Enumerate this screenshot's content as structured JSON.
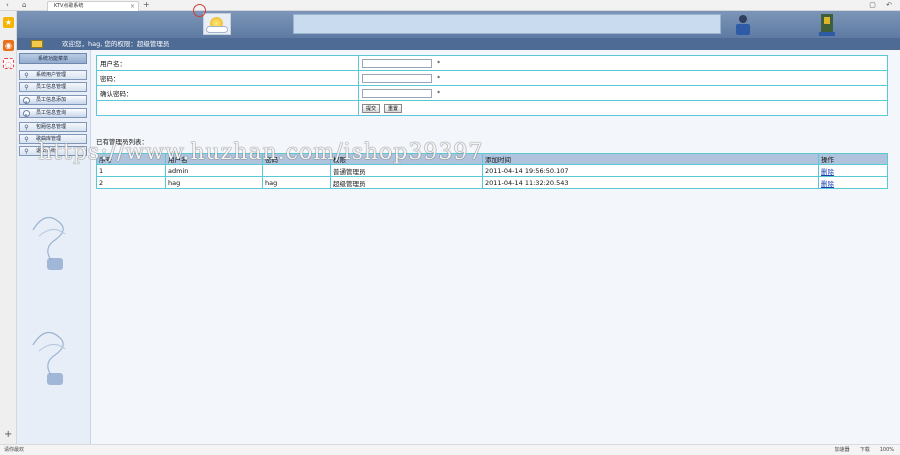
{
  "browser": {
    "tab_title": "KTV点歌系统",
    "status_left": "请你最欢",
    "status_right": [
      "加速器",
      "下载",
      "100%"
    ]
  },
  "header": {
    "welcome": "欢迎您，hag, 您的权限：超级管理员"
  },
  "sidebar": {
    "title": "系统功能菜单",
    "items": [
      {
        "label": "系统用户管理",
        "type": "group"
      },
      {
        "label": "员工信息管理",
        "type": "group"
      },
      {
        "label": "员工信息添加",
        "type": "sub"
      },
      {
        "label": "员工信息查询",
        "type": "sub"
      },
      {
        "label": "包厢信息管理",
        "type": "group"
      },
      {
        "label": "歌曲库管理",
        "type": "group"
      },
      {
        "label": "退出系统",
        "type": "group"
      }
    ]
  },
  "form": {
    "username_label": "用户名：",
    "password_label": "密码：",
    "confirm_label": "确认密码：",
    "required_mark": "*",
    "username_value": "",
    "password_value": "",
    "confirm_value": "",
    "submit_label": "提交",
    "reset_label": "重置"
  },
  "admin_list": {
    "title": "已有管理员列表：",
    "columns": [
      "序号",
      "用户名",
      "密码",
      "权限",
      "添加时间",
      "操作"
    ],
    "rows": [
      [
        "1",
        "admin",
        "",
        "普通管理员",
        "2011-04-14 19:56:50.107",
        "删除"
      ],
      [
        "2",
        "hag",
        "hag",
        "超级管理员",
        "2011-04-14 11:32:20.543",
        "删除"
      ]
    ]
  },
  "watermark": "https://www.huzhan.com/ishop39397"
}
